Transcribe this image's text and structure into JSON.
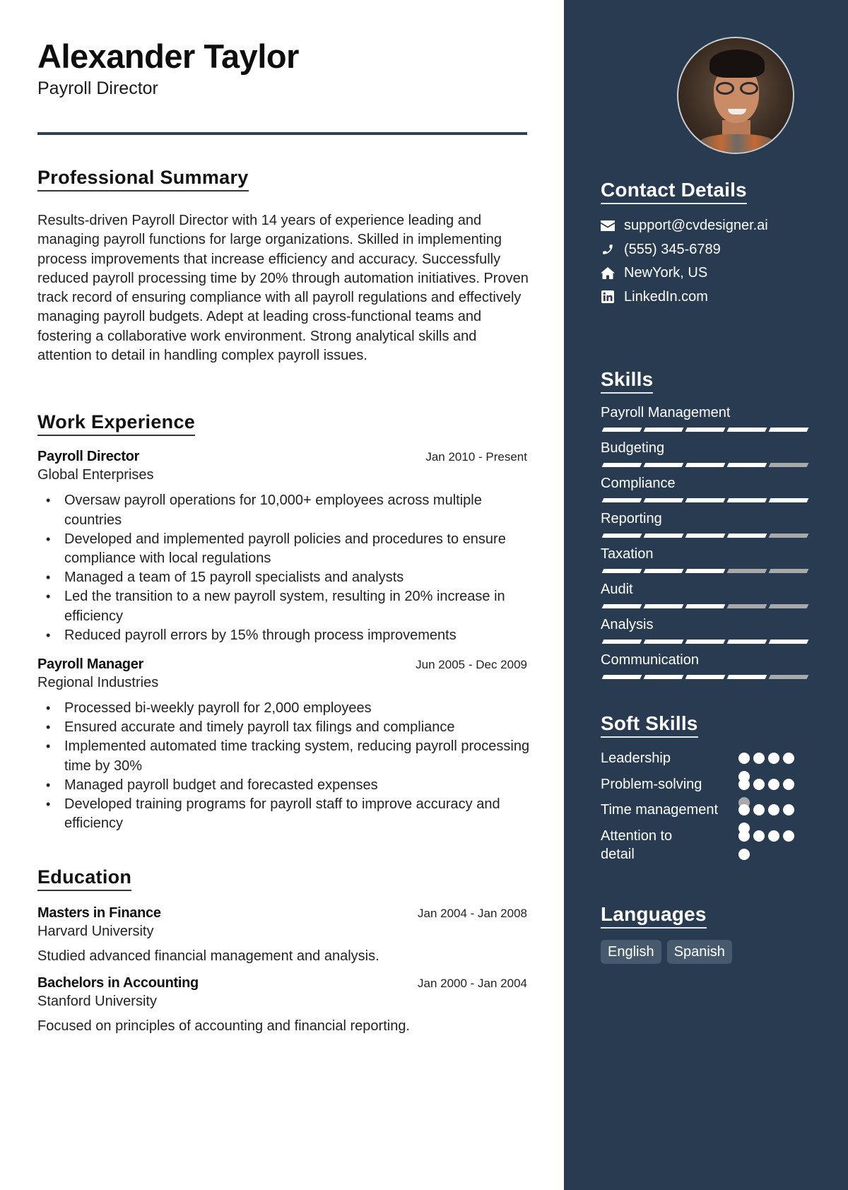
{
  "header": {
    "name": "Alexander Taylor",
    "title": "Payroll Director"
  },
  "summary": {
    "heading": "Professional Summary",
    "text": "Results-driven Payroll Director with 14 years of experience leading and managing payroll functions for large organizations. Skilled in implementing process improvements that increase efficiency and accuracy. Successfully reduced payroll processing time by 20% through automation initiatives. Proven track record of ensuring compliance with all payroll regulations and effectively managing payroll budgets. Adept at leading cross-functional teams and fostering a collaborative work environment. Strong analytical skills and attention to detail in handling complex payroll issues."
  },
  "experience": {
    "heading": "Work Experience",
    "jobs": [
      {
        "role": "Payroll Director",
        "dates": "Jan 2010 - Present",
        "company": "Global Enterprises",
        "bullets": [
          "Oversaw payroll operations for 10,000+ employees across multiple countries",
          "Developed and implemented payroll policies and procedures to ensure compliance with local regulations",
          "Managed a team of 15 payroll specialists and analysts",
          "Led the transition to a new payroll system, resulting in 20% increase in efficiency",
          "Reduced payroll errors by 15% through process improvements"
        ]
      },
      {
        "role": "Payroll Manager",
        "dates": "Jun 2005 - Dec 2009",
        "company": "Regional Industries",
        "bullets": [
          "Processed bi-weekly payroll for 2,000 employees",
          "Ensured accurate and timely payroll tax filings and compliance",
          "Implemented automated time tracking system, reducing payroll processing time by 30%",
          "Managed payroll budget and forecasted expenses",
          "Developed training programs for payroll staff to improve accuracy and efficiency"
        ]
      }
    ]
  },
  "education": {
    "heading": "Education",
    "items": [
      {
        "degree": "Masters in Finance",
        "dates": "Jan 2004 - Jan 2008",
        "school": "Harvard University",
        "description": "Studied advanced financial management and analysis."
      },
      {
        "degree": "Bachelors in Accounting",
        "dates": "Jan 2000 - Jan 2004",
        "school": "Stanford University",
        "description": "Focused on principles of accounting and financial reporting."
      }
    ]
  },
  "sidebar": {
    "photo_alt": "Profile photo",
    "contact": {
      "heading": "Contact Details",
      "items": [
        {
          "icon": "envelope-icon",
          "text": "support@cvdesigner.ai"
        },
        {
          "icon": "phone-icon",
          "text": "(555) 345-6789"
        },
        {
          "icon": "home-icon",
          "text": "NewYork, US"
        },
        {
          "icon": "linkedin-icon",
          "text": "LinkedIn.com"
        }
      ]
    },
    "skills": {
      "heading": "Skills",
      "max": 5,
      "items": [
        {
          "name": "Payroll Management",
          "level": 5
        },
        {
          "name": "Budgeting",
          "level": 4
        },
        {
          "name": "Compliance",
          "level": 5
        },
        {
          "name": "Reporting",
          "level": 4
        },
        {
          "name": "Taxation",
          "level": 3
        },
        {
          "name": "Audit",
          "level": 3
        },
        {
          "name": "Analysis",
          "level": 5
        },
        {
          "name": "Communication",
          "level": 4
        }
      ]
    },
    "soft_skills": {
      "heading": "Soft Skills",
      "max": 5,
      "items": [
        {
          "name": "Leadership",
          "level": 5
        },
        {
          "name": "Problem-solving",
          "level": 4
        },
        {
          "name": "Time management",
          "level": 5
        },
        {
          "name": "Attention to detail",
          "level": 5
        }
      ]
    },
    "languages": {
      "heading": "Languages",
      "items": [
        "English",
        "Spanish"
      ]
    }
  },
  "colors": {
    "sidebar_bg": "#283b51",
    "divider": "#2d4257",
    "bar_on": "#ffffff",
    "bar_off": "#a9a9ab",
    "chip_bg": "#47596c"
  }
}
